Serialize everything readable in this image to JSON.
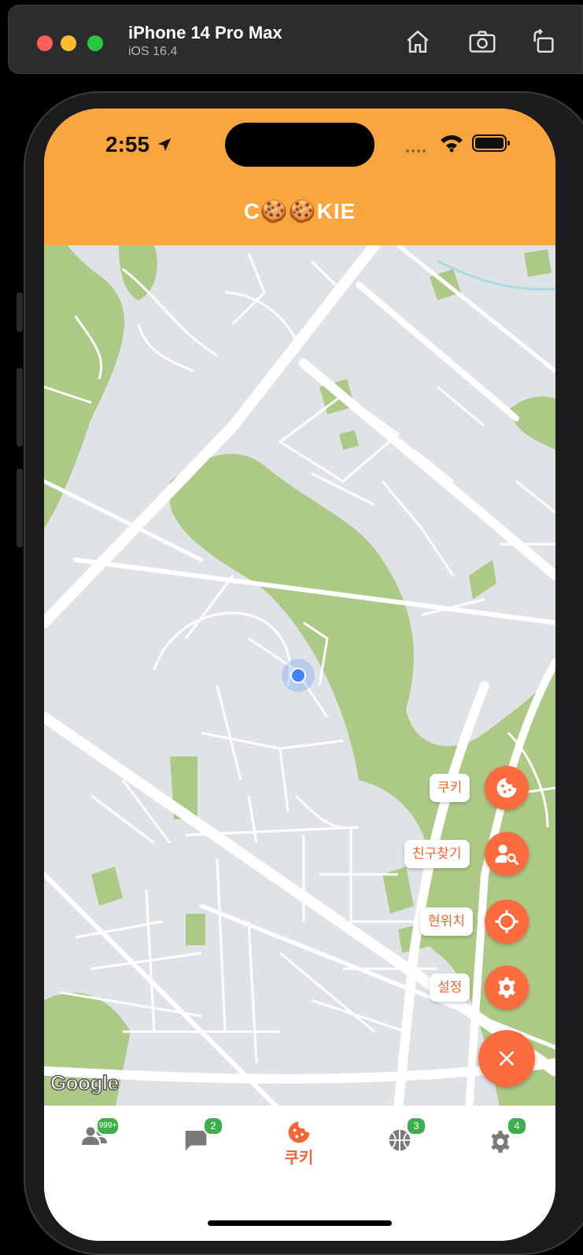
{
  "simulator": {
    "device": "iPhone 14 Pro Max",
    "os": "iOS 16.4",
    "icons": [
      "home-icon",
      "screenshot-icon",
      "rotate-icon"
    ]
  },
  "status_bar": {
    "time": "2:55"
  },
  "app": {
    "title": "C🍪🍪KIE",
    "colors": {
      "header": "#fba53f",
      "accent": "#fb6b3e",
      "badge": "#3cb04b",
      "label_text": "#f26535"
    }
  },
  "map": {
    "attribution": "Google"
  },
  "fab_menu": {
    "items": [
      {
        "label": "쿠키",
        "icon": "cookie-icon"
      },
      {
        "label": "친구찾기",
        "icon": "find-friend-icon"
      },
      {
        "label": "현위치",
        "icon": "crosshair-icon"
      },
      {
        "label": "설정",
        "icon": "gear-icon"
      }
    ],
    "close_icon": "close-icon"
  },
  "tabbar": {
    "tabs": [
      {
        "icon": "friends-icon",
        "badge": "999+"
      },
      {
        "icon": "chat-icon",
        "badge": "2"
      },
      {
        "icon": "cookie-icon",
        "label": "쿠키",
        "active": true
      },
      {
        "icon": "basketball-icon",
        "badge": "3"
      },
      {
        "icon": "gear-icon",
        "badge": "4"
      }
    ]
  }
}
